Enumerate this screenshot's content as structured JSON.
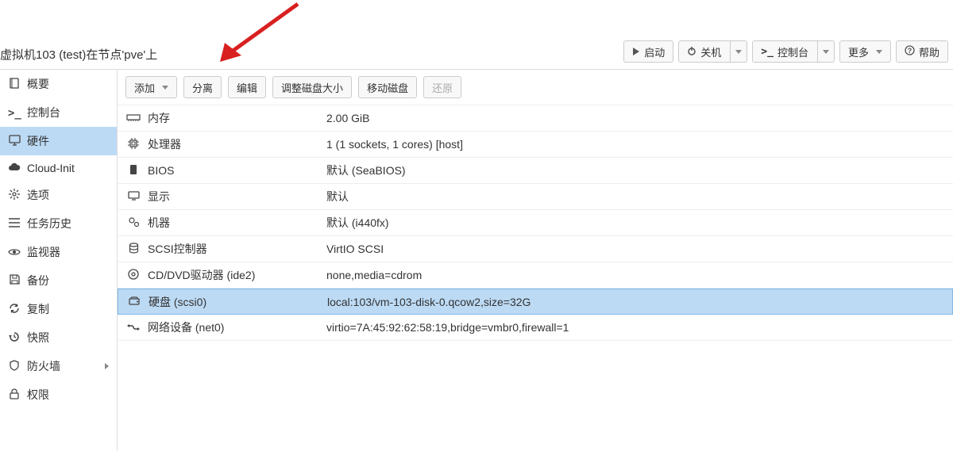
{
  "header": {
    "title": "虚拟机103 (test)在节点'pve'上",
    "start": "启动",
    "shutdown": "关机",
    "console": "控制台",
    "more": "更多",
    "help": "帮助"
  },
  "sidebar": {
    "items": [
      {
        "icon": "book",
        "label": "概要"
      },
      {
        "icon": "terminal",
        "label": "控制台"
      },
      {
        "icon": "desktop",
        "label": "硬件",
        "active": true
      },
      {
        "icon": "cloud",
        "label": "Cloud-Init"
      },
      {
        "icon": "gear",
        "label": "选项"
      },
      {
        "icon": "list",
        "label": "任务历史"
      },
      {
        "icon": "eye",
        "label": "监视器"
      },
      {
        "icon": "save",
        "label": "备份"
      },
      {
        "icon": "refresh",
        "label": "复制"
      },
      {
        "icon": "clock",
        "label": "快照"
      },
      {
        "icon": "shield",
        "label": "防火墙",
        "expandable": true
      },
      {
        "icon": "lock",
        "label": "权限"
      }
    ]
  },
  "toolbar": {
    "add": "添加",
    "detach": "分离",
    "edit": "编辑",
    "resize": "调整磁盘大小",
    "move": "移动磁盘",
    "restore": "还原"
  },
  "hardware": {
    "rows": [
      {
        "icon": "memory",
        "label": "内存",
        "value": "2.00 GiB"
      },
      {
        "icon": "cpu",
        "label": "处理器",
        "value": "1 (1 sockets, 1 cores) [host]"
      },
      {
        "icon": "chip",
        "label": "BIOS",
        "value": "默认 (SeaBIOS)"
      },
      {
        "icon": "display",
        "label": "显示",
        "value": "默认"
      },
      {
        "icon": "cogs",
        "label": "机器",
        "value": "默认 (i440fx)"
      },
      {
        "icon": "database",
        "label": "SCSI控制器",
        "value": "VirtIO SCSI"
      },
      {
        "icon": "disc",
        "label": "CD/DVD驱动器 (ide2)",
        "value": "none,media=cdrom"
      },
      {
        "icon": "hdd",
        "label": "硬盘 (scsi0)",
        "value": "local:103/vm-103-disk-0.qcow2,size=32G",
        "selected": true
      },
      {
        "icon": "network",
        "label": "网络设备 (net0)",
        "value": "virtio=7A:45:92:62:58:19,bridge=vmbr0,firewall=1"
      }
    ]
  }
}
